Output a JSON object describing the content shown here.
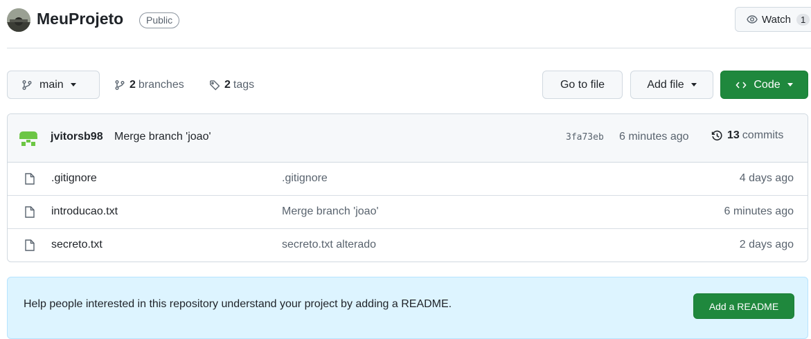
{
  "repo": {
    "name": "MeuProjeto",
    "visibility": "Public",
    "watch_label": "Watch",
    "watch_count": "1"
  },
  "toolbar": {
    "branch": "main",
    "branches_count": "2",
    "branches_label": "branches",
    "tags_count": "2",
    "tags_label": "tags",
    "goto_file": "Go to file",
    "add_file": "Add file",
    "code": "Code"
  },
  "latest_commit": {
    "author": "jvitorsb98",
    "message": "Merge branch 'joao'",
    "hash": "3fa73eb",
    "time": "6 minutes ago",
    "commits_count": "13",
    "commits_label": "commits"
  },
  "files": [
    {
      "name": ".gitignore",
      "message": ".gitignore",
      "time": "4 days ago"
    },
    {
      "name": "introducao.txt",
      "message": "Merge branch 'joao'",
      "time": "6 minutes ago"
    },
    {
      "name": "secreto.txt",
      "message": "secreto.txt alterado",
      "time": "2 days ago"
    }
  ],
  "readme": {
    "text": "Help people interested in this repository understand your project by adding a README.",
    "button": "Add a README"
  },
  "colors": {
    "primary_green": "#1f883d",
    "banner_bg": "#ddf4ff",
    "bot_avatar_green": "#6cc644"
  }
}
